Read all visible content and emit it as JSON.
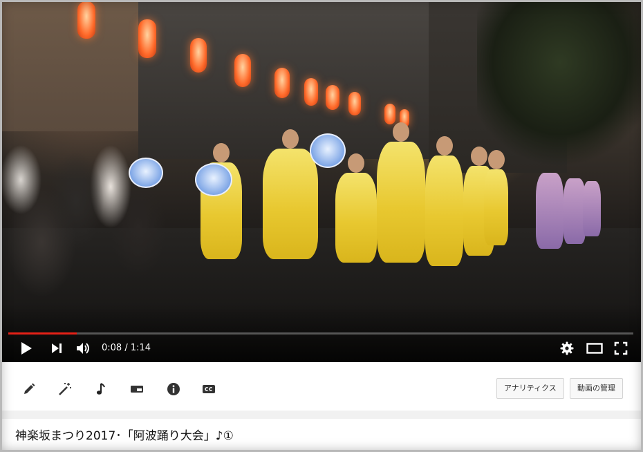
{
  "player": {
    "time_current": "0:08",
    "time_separator": " / ",
    "time_total": "1:14",
    "progress_fraction": 0.109,
    "progress_color": "#e62117",
    "icons": {
      "play": "play-icon",
      "next": "next-icon",
      "volume": "volume-icon",
      "settings": "gear-icon",
      "theater": "theater-mode-icon",
      "fullscreen": "fullscreen-icon"
    }
  },
  "toolbar": {
    "tools": [
      "pencil-icon",
      "magic-wand-icon",
      "music-note-icon",
      "card-icon",
      "info-icon",
      "cc-icon"
    ],
    "analytics_label": "アナリティクス",
    "manage_label": "動画の管理"
  },
  "video": {
    "title": "神楽坂まつり2017･「阿波踊り大会」♪①"
  }
}
